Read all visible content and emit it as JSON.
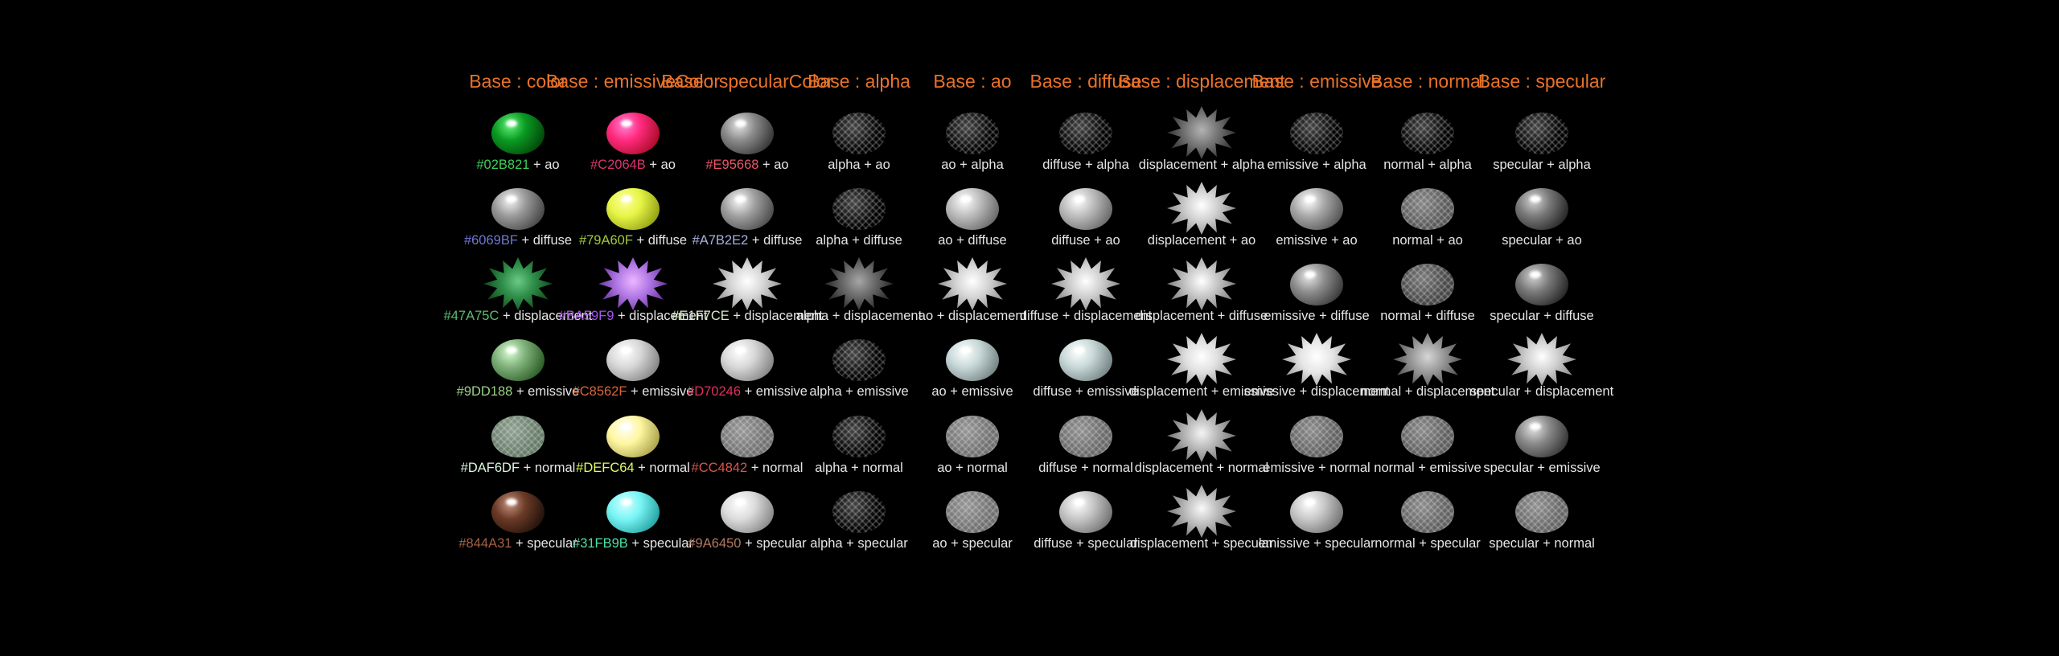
{
  "headers": [
    "Base : color",
    "Base : emissiveColor",
    "Base : specularColor",
    "Base : alpha",
    "Base : ao",
    "Base : diffuse",
    "Base : displacement",
    "Base : emissive",
    "Base : normal",
    "Base : specular"
  ],
  "rows": [
    [
      {
        "color_label": "#02B821",
        "label_color": "#3bd05a",
        "suffix": " + ao",
        "tint": "#0a9a22",
        "style": "sphere"
      },
      {
        "color_label": "#C2064B",
        "label_color": "#d8336e",
        "suffix": " + ao",
        "tint": "#ff2a7d",
        "style": "sphere"
      },
      {
        "color_label": "#E95668",
        "label_color": "#e95668",
        "suffix": " + ao",
        "tint": "#8a8a8a",
        "style": "sphere"
      },
      {
        "color_label": "",
        "label_color": "#e6e6e6",
        "suffix": "alpha + ao",
        "tint": "#555555",
        "style": "mesh"
      },
      {
        "color_label": "",
        "label_color": "#e6e6e6",
        "suffix": "ao + alpha",
        "tint": "#555555",
        "style": "mesh"
      },
      {
        "color_label": "",
        "label_color": "#e6e6e6",
        "suffix": "diffuse + alpha",
        "tint": "#444444",
        "style": "mesh"
      },
      {
        "color_label": "",
        "label_color": "#e6e6e6",
        "suffix": "displacement + alpha",
        "tint": "#777777",
        "style": "burst"
      },
      {
        "color_label": "",
        "label_color": "#e6e6e6",
        "suffix": "emissive + alpha",
        "tint": "#444444",
        "style": "mesh"
      },
      {
        "color_label": "",
        "label_color": "#e6e6e6",
        "suffix": "normal + alpha",
        "tint": "#444444",
        "style": "mesh"
      },
      {
        "color_label": "",
        "label_color": "#e6e6e6",
        "suffix": "specular + alpha",
        "tint": "#555555",
        "style": "mesh"
      }
    ],
    [
      {
        "color_label": "#6069BF",
        "label_color": "#6f78d0",
        "suffix": " + diffuse",
        "tint": "#9a9a9a",
        "style": "sphere"
      },
      {
        "color_label": "#79A60F",
        "label_color": "#a3c93a",
        "suffix": " + diffuse",
        "tint": "#e6f545",
        "style": "sphere"
      },
      {
        "color_label": "#A7B2E2",
        "label_color": "#a7b2e2",
        "suffix": " + diffuse",
        "tint": "#a0a0a0",
        "style": "sphere"
      },
      {
        "color_label": "",
        "label_color": "#e6e6e6",
        "suffix": "alpha + diffuse",
        "tint": "#444444",
        "style": "mesh"
      },
      {
        "color_label": "",
        "label_color": "#e6e6e6",
        "suffix": "ao + diffuse",
        "tint": "#bdbdbd",
        "style": "sphere"
      },
      {
        "color_label": "",
        "label_color": "#e6e6e6",
        "suffix": "diffuse + ao",
        "tint": "#bdbdbd",
        "style": "sphere"
      },
      {
        "color_label": "",
        "label_color": "#e6e6e6",
        "suffix": "displacement + ao",
        "tint": "#d0d0d0",
        "style": "burst"
      },
      {
        "color_label": "",
        "label_color": "#e6e6e6",
        "suffix": "emissive + ao",
        "tint": "#a8a8a8",
        "style": "sphere"
      },
      {
        "color_label": "",
        "label_color": "#e6e6e6",
        "suffix": "normal + ao",
        "tint": "#b8b8b8",
        "style": "mesh"
      },
      {
        "color_label": "",
        "label_color": "#e6e6e6",
        "suffix": "specular + ao",
        "tint": "#7a7a7a",
        "style": "sphere"
      }
    ],
    [
      {
        "color_label": "#47A75C",
        "label_color": "#5dbd72",
        "suffix": " + displacement",
        "tint": "#2f8f4a",
        "style": "burst"
      },
      {
        "color_label": "#BA59F9",
        "label_color": "#a455e8",
        "suffix": " + displacement",
        "tint": "#b27ae6",
        "style": "burst"
      },
      {
        "color_label": "#E1F7CE",
        "label_color": "#d7ecc4",
        "suffix": " + displacement",
        "tint": "#d8d8d8",
        "style": "burst"
      },
      {
        "color_label": "",
        "label_color": "#e6e6e6",
        "suffix": "alpha + displacement",
        "tint": "#6a6a6a",
        "style": "burst"
      },
      {
        "color_label": "",
        "label_color": "#e6e6e6",
        "suffix": "ao + displacement",
        "tint": "#d6d6d6",
        "style": "burst"
      },
      {
        "color_label": "",
        "label_color": "#e6e6e6",
        "suffix": "diffuse + displacement",
        "tint": "#cfcfcf",
        "style": "burst"
      },
      {
        "color_label": "",
        "label_color": "#e6e6e6",
        "suffix": "displacement + diffuse",
        "tint": "#c6c6c6",
        "style": "burst"
      },
      {
        "color_label": "",
        "label_color": "#e6e6e6",
        "suffix": "emissive + diffuse",
        "tint": "#8e8e8e",
        "style": "sphere"
      },
      {
        "color_label": "",
        "label_color": "#e6e6e6",
        "suffix": "normal + diffuse",
        "tint": "#a6a6a6",
        "style": "mesh"
      },
      {
        "color_label": "",
        "label_color": "#e6e6e6",
        "suffix": "specular + diffuse",
        "tint": "#7a7a7a",
        "style": "sphere"
      }
    ],
    [
      {
        "color_label": "#9DD188",
        "label_color": "#9dd188",
        "suffix": " + emissive",
        "tint": "#7fb07a",
        "style": "sphere"
      },
      {
        "color_label": "#C8562F",
        "label_color": "#d8663a",
        "suffix": " + emissive",
        "tint": "#d8d8d8",
        "style": "sphere"
      },
      {
        "color_label": "#D70246",
        "label_color": "#e0305e",
        "suffix": " + emissive",
        "tint": "#d8d8d8",
        "style": "sphere"
      },
      {
        "color_label": "",
        "label_color": "#e6e6e6",
        "suffix": "alpha + emissive",
        "tint": "#555555",
        "style": "mesh"
      },
      {
        "color_label": "",
        "label_color": "#e6e6e6",
        "suffix": "ao + emissive",
        "tint": "#c8d8d8",
        "style": "sphere"
      },
      {
        "color_label": "",
        "label_color": "#e6e6e6",
        "suffix": "diffuse + emissive",
        "tint": "#c8d8d8",
        "style": "sphere"
      },
      {
        "color_label": "",
        "label_color": "#e6e6e6",
        "suffix": "displacement + emissive",
        "tint": "#e0e0e0",
        "style": "burst"
      },
      {
        "color_label": "",
        "label_color": "#e6e6e6",
        "suffix": "emissive + displacement",
        "tint": "#e6e6e6",
        "style": "burst"
      },
      {
        "color_label": "",
        "label_color": "#e6e6e6",
        "suffix": "normal + displacement",
        "tint": "#9a9a9a",
        "style": "burst"
      },
      {
        "color_label": "",
        "label_color": "#e6e6e6",
        "suffix": "specular + displacement",
        "tint": "#d0d0d0",
        "style": "burst"
      }
    ],
    [
      {
        "color_label": "#DAF6DF",
        "label_color": "#daf6df",
        "suffix": " + normal",
        "tint": "#c6dcc8",
        "style": "mesh"
      },
      {
        "color_label": "#DEFC64",
        "label_color": "#defc64",
        "suffix": " + normal",
        "tint": "#fff6a0",
        "style": "sphere"
      },
      {
        "color_label": "#CC4842",
        "label_color": "#d8554e",
        "suffix": " + normal",
        "tint": "#d0d0d0",
        "style": "mesh"
      },
      {
        "color_label": "",
        "label_color": "#e6e6e6",
        "suffix": "alpha + normal",
        "tint": "#555555",
        "style": "mesh"
      },
      {
        "color_label": "",
        "label_color": "#e6e6e6",
        "suffix": "ao + normal",
        "tint": "#cfcfcf",
        "style": "mesh"
      },
      {
        "color_label": "",
        "label_color": "#e6e6e6",
        "suffix": "diffuse + normal",
        "tint": "#c8c8c8",
        "style": "mesh"
      },
      {
        "color_label": "",
        "label_color": "#e6e6e6",
        "suffix": "displacement + normal",
        "tint": "#b8b8b8",
        "style": "burst"
      },
      {
        "color_label": "",
        "label_color": "#e6e6e6",
        "suffix": "emissive + normal",
        "tint": "#c0c0c0",
        "style": "mesh"
      },
      {
        "color_label": "",
        "label_color": "#e6e6e6",
        "suffix": "normal + emissive",
        "tint": "#bdbdbd",
        "style": "mesh"
      },
      {
        "color_label": "",
        "label_color": "#e6e6e6",
        "suffix": "specular + emissive",
        "tint": "#8a8a8a",
        "style": "sphere"
      }
    ],
    [
      {
        "color_label": "#844A31",
        "label_color": "#a56043",
        "suffix": " + specular",
        "tint": "#6b3a26",
        "style": "sphere"
      },
      {
        "color_label": "#31FB9B",
        "label_color": "#4ce0a4",
        "suffix": " + specular",
        "tint": "#7af5f5",
        "style": "sphere"
      },
      {
        "color_label": "#9A6450",
        "label_color": "#b07860",
        "suffix": " + specular",
        "tint": "#dcdcdc",
        "style": "sphere"
      },
      {
        "color_label": "",
        "label_color": "#e6e6e6",
        "suffix": "alpha + specular",
        "tint": "#555555",
        "style": "mesh"
      },
      {
        "color_label": "",
        "label_color": "#e6e6e6",
        "suffix": "ao + specular",
        "tint": "#cfcfcf",
        "style": "mesh"
      },
      {
        "color_label": "",
        "label_color": "#e6e6e6",
        "suffix": "diffuse + specular",
        "tint": "#c6c6c6",
        "style": "sphere"
      },
      {
        "color_label": "",
        "label_color": "#e6e6e6",
        "suffix": "displacement + specular",
        "tint": "#bdbdbd",
        "style": "burst"
      },
      {
        "color_label": "",
        "label_color": "#e6e6e6",
        "suffix": "emissive + specular",
        "tint": "#c8c8c8",
        "style": "sphere"
      },
      {
        "color_label": "",
        "label_color": "#e6e6e6",
        "suffix": "normal + specular",
        "tint": "#c0c0c0",
        "style": "mesh"
      },
      {
        "color_label": "",
        "label_color": "#e6e6e6",
        "suffix": "specular + normal",
        "tint": "#c6c6c6",
        "style": "mesh"
      }
    ]
  ]
}
